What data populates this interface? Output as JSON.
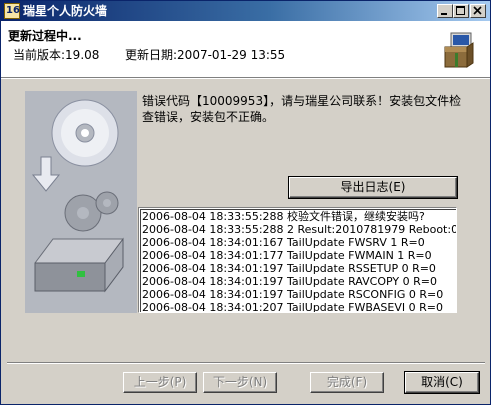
{
  "window": {
    "title": "瑞星个人防火墙",
    "app_icon_glyph": "16",
    "controls": [
      "minimize",
      "maximize",
      "close"
    ]
  },
  "header": {
    "title": "更新过程中...",
    "version_label": "当前版本:19.08",
    "date_label": "更新日期:2007-01-29 13:55",
    "icon": "install-package-icon"
  },
  "main": {
    "error_message": "错误代码【10009953】，请与瑞星公司联系！安装包文件检查错误，安装包不正确。",
    "export_button_label": "导出日志(E)",
    "log": [
      "2006-08-04 18:33:55:288  校验文件错误，继续安装吗?",
      "2006-08-04 18:33:55:288  2 Result:2010781979 Reboot:0",
      "2006-08-04 18:34:01:167  TailUpdate FWSRV 1 R=0",
      "2006-08-04 18:34:01:177  TailUpdate FWMAIN 1 R=0",
      "2006-08-04 18:34:01:197  TailUpdate RSSETUP 0 R=0",
      "2006-08-04 18:34:01:197  TailUpdate RAVCOPY 0 R=0",
      "2006-08-04 18:34:01:197  TailUpdate RSCONFIG 0 R=0",
      "2006-08-04 18:34:01:207  TailUpdate FWBASEVI 0 R=0"
    ]
  },
  "footer": {
    "back_label": "上一步(P)",
    "next_label": "下一步(N)",
    "finish_label": "完成(F)",
    "cancel_label": "取消(C)"
  },
  "colors": {
    "titlebar_start": "#0a246a",
    "titlebar_end": "#a6caf0",
    "face": "#d4d0c8",
    "side_panel": "#b4b8c0"
  }
}
